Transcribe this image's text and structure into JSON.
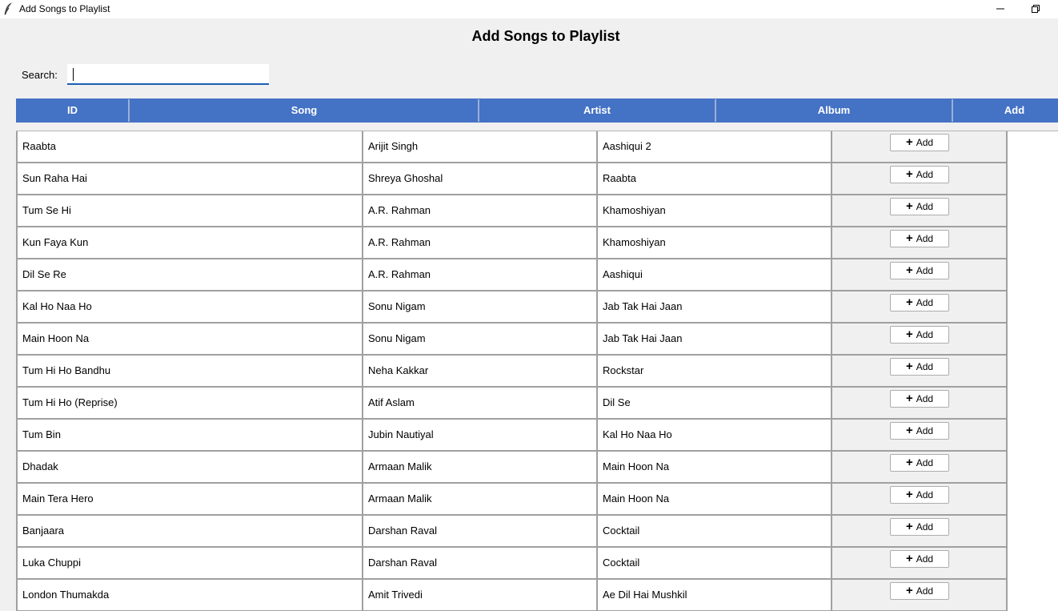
{
  "window": {
    "title": "Add Songs to Playlist",
    "icon": "feather-icon"
  },
  "heading": "Add Songs to Playlist",
  "search": {
    "label": "Search:",
    "value": ""
  },
  "colors": {
    "header_bg": "#4472c4",
    "header_text": "#ffffff",
    "input_underline": "#1a5fb4"
  },
  "table": {
    "columns": [
      "ID",
      "Song",
      "Artist",
      "Album",
      "Add"
    ],
    "add_button_label": "Add",
    "add_button_icon": "plus-icon",
    "rows": [
      {
        "song": "Raabta",
        "artist": "Arijit Singh",
        "album": "Aashiqui 2"
      },
      {
        "song": "Sun Raha Hai",
        "artist": "Shreya Ghoshal",
        "album": "Raabta"
      },
      {
        "song": "Tum Se Hi",
        "artist": "A.R. Rahman",
        "album": "Khamoshiyan"
      },
      {
        "song": "Kun Faya Kun",
        "artist": "A.R. Rahman",
        "album": "Khamoshiyan"
      },
      {
        "song": "Dil Se Re",
        "artist": "A.R. Rahman",
        "album": "Aashiqui"
      },
      {
        "song": "Kal Ho Naa Ho",
        "artist": "Sonu Nigam",
        "album": "Jab Tak Hai Jaan"
      },
      {
        "song": "Main Hoon Na",
        "artist": "Sonu Nigam",
        "album": "Jab Tak Hai Jaan"
      },
      {
        "song": "Tum Hi Ho Bandhu",
        "artist": "Neha Kakkar",
        "album": "Rockstar"
      },
      {
        "song": "Tum Hi Ho (Reprise)",
        "artist": "Atif Aslam",
        "album": "Dil Se"
      },
      {
        "song": "Tum Bin",
        "artist": "Jubin Nautiyal",
        "album": "Kal Ho Naa Ho"
      },
      {
        "song": "Dhadak",
        "artist": "Armaan Malik",
        "album": "Main Hoon Na"
      },
      {
        "song": "Main Tera Hero",
        "artist": "Armaan Malik",
        "album": "Main Hoon Na"
      },
      {
        "song": "Banjaara",
        "artist": "Darshan Raval",
        "album": "Cocktail"
      },
      {
        "song": "Luka Chuppi",
        "artist": "Darshan Raval",
        "album": "Cocktail"
      },
      {
        "song": "London Thumakda",
        "artist": "Amit Trivedi",
        "album": "Ae Dil Hai Mushkil"
      }
    ]
  }
}
